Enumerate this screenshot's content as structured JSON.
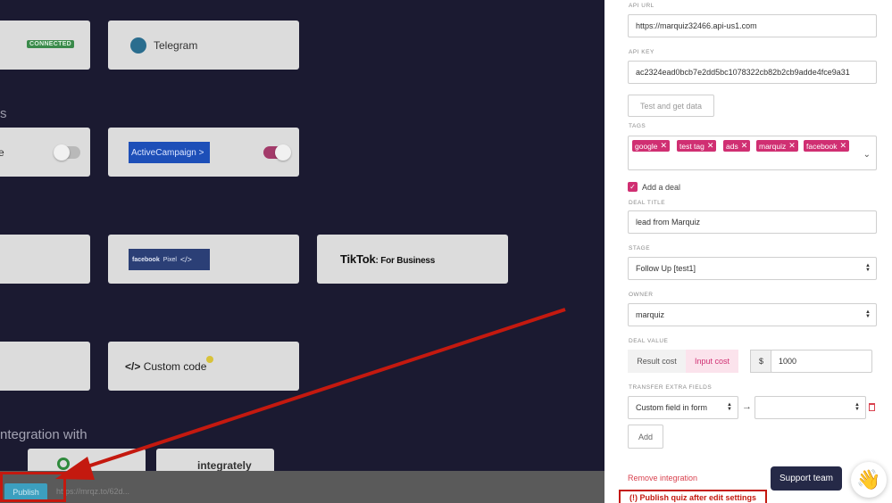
{
  "left": {
    "connected_badge": "CONNECTED",
    "telegram_label": "Telegram",
    "section_s": "s",
    "partial_e": "e",
    "activecampaign_label": "ActiveCampaign >",
    "facebook_text": "facebook",
    "facebook_pixel": "Pixel",
    "facebook_code": "</>",
    "tiktok_main": "TikTok",
    "tiktok_sub": ": For Business",
    "custom_code_glyph": "</>",
    "custom_code_label": "Custom code",
    "integration_with": "ntegration with",
    "publish_label": "Publish",
    "bottom_url": "https://mrqz.to/62d..."
  },
  "panel": {
    "api_url_label": "API URL",
    "api_url_value": "https://marquiz32466.api-us1.com",
    "api_key_label": "API KEY",
    "api_key_value": "ac2324ead0bcb7e2dd5bc1078322cb82b2cb9adde4fce9a31",
    "test_button": "Test and get data",
    "tags_label": "TAGS",
    "tags": [
      "google",
      "test tag",
      "ads",
      "marquiz",
      "facebook"
    ],
    "add_deal_label": "Add a deal",
    "deal_title_label": "DEAL TITLE",
    "deal_title_value": "lead from Marquiz",
    "stage_label": "STAGE",
    "stage_value": "Follow Up [test1]",
    "owner_label": "OWNER",
    "owner_value": "marquiz",
    "deal_value_label": "DEAL VALUE",
    "result_cost": "Result cost",
    "input_cost": "Input cost",
    "currency": "$",
    "deal_amount": "1000",
    "transfer_label": "TRANSFER EXTRA FIELDS",
    "custom_field_value": "Custom field in form",
    "arrow_glyph": "→",
    "add_button": "Add",
    "remove_integration": "Remove integration",
    "support_team": "Support team",
    "wave_glyph": "👋",
    "publish_warning": "(!) Publish quiz after edit settings"
  },
  "colors": {
    "accent_pink": "#d02f72",
    "annotation_red": "#c4190f",
    "support_navy": "#252947"
  }
}
